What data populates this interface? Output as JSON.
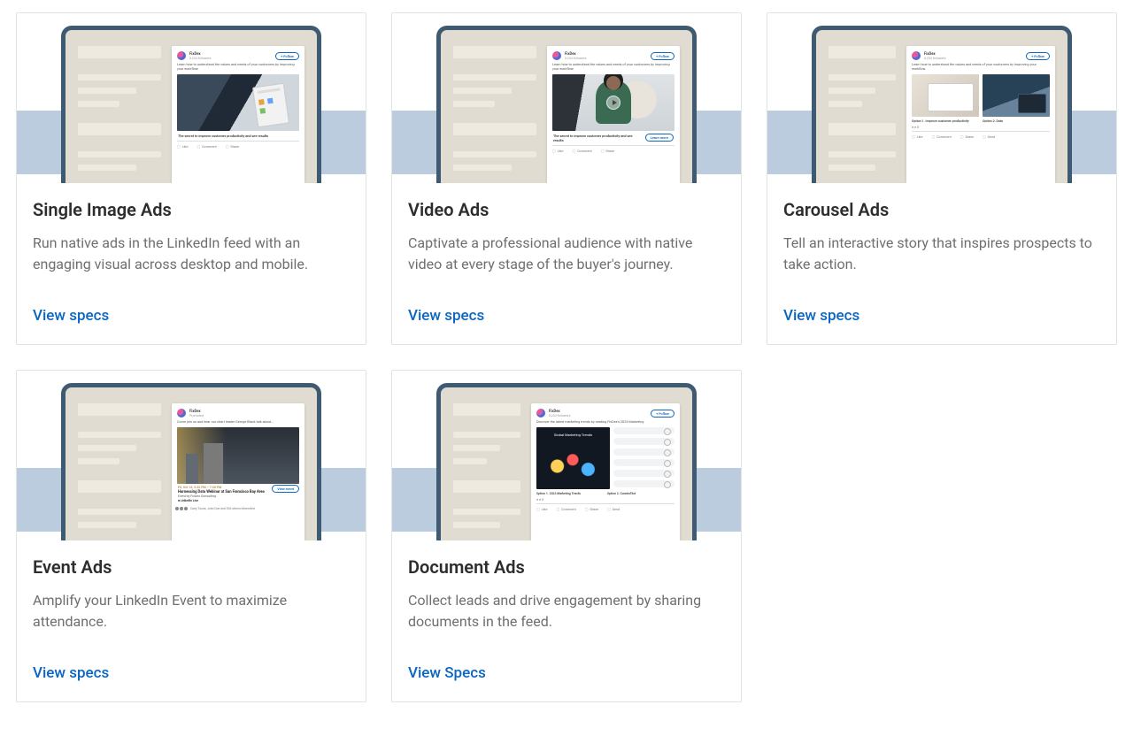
{
  "mock": {
    "brand": "FixDex",
    "follow": "+ Follow",
    "promo_copy": "Learn how to understand the values and needs of your customers by improving your workflow.",
    "caption_single": "The secret to improve customer productivity and see results",
    "caption_video": "The secret to improve customer productivity and see results",
    "learn_more": "Learn more",
    "actions3": [
      "Like",
      "Comment",
      "Share"
    ],
    "actions4": [
      "Like",
      "Comment",
      "Share",
      "Send"
    ],
    "carousel": {
      "opt1": "Option 1. Improve customer productivity",
      "opt2": "Option 2. Data"
    },
    "event": {
      "intro": "Come join us and hear our chart leader George Black talk about...",
      "date": "Fri, Oct 18, 5:32 PM – 7:30 PM",
      "title": "Harnessing Data Webinar at San Francisco Bay Area",
      "host": "Event by FixDex Consulting",
      "platform": "LinkedIn Live",
      "view": "View event",
      "attendees": "Carly Tusca, John Doe and 526 others interested"
    },
    "doc": {
      "banner": "Discover the latest marketing trends by reading FixDex's 2023 Marketing",
      "title": "Global Marketing Trends",
      "opt1": "Option 1. 2023 Marketing Trends",
      "opt2": "Option 2. Curated list"
    }
  },
  "cards": [
    {
      "id": "single-image",
      "title": "Single Image Ads",
      "desc": "Run native ads in the LinkedIn feed with an engaging visual across desktop and mobile.",
      "cta": "View specs"
    },
    {
      "id": "video",
      "title": "Video Ads",
      "desc": "Captivate a professional audience with native video at every stage of the buyer's journey.",
      "cta": "View specs"
    },
    {
      "id": "carousel",
      "title": "Carousel Ads",
      "desc": "Tell an interactive story that inspires prospects to take action.",
      "cta": "View specs"
    },
    {
      "id": "event",
      "title": "Event Ads",
      "desc": "Amplify your LinkedIn Event to maximize attendance.",
      "cta": "View specs"
    },
    {
      "id": "document",
      "title": "Document Ads",
      "desc": "Collect leads and drive engagement by sharing documents in the feed.",
      "cta": "View Specs"
    }
  ]
}
